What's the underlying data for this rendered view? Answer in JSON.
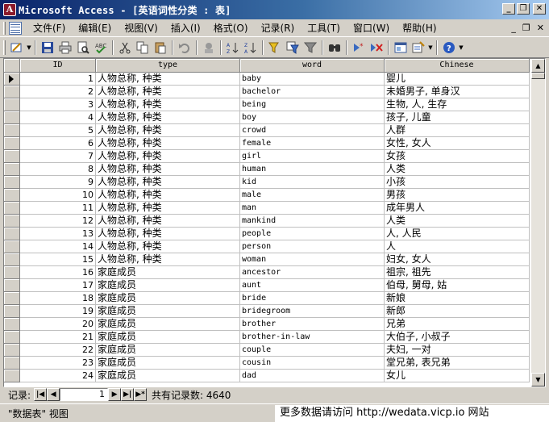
{
  "window": {
    "title": "Microsoft Access - [英语词性分类 : 表]",
    "buttons": {
      "minimize": "_",
      "restore": "❐",
      "close": "✕"
    }
  },
  "menubar": {
    "items": [
      "文件(F)",
      "编辑(E)",
      "视图(V)",
      "插入(I)",
      "格式(O)",
      "记录(R)",
      "工具(T)",
      "窗口(W)",
      "帮助(H)"
    ],
    "doc_controls": {
      "minimize": "_",
      "restore": "❐",
      "close": "✕"
    }
  },
  "toolbar": {
    "icons": [
      "view-icon",
      "save-icon",
      "print-icon",
      "print-preview-icon",
      "spelling-icon",
      "cut-icon",
      "copy-icon",
      "paste-icon",
      "undo-icon",
      "insert-object-icon",
      "sort-ascending-icon",
      "sort-descending-icon",
      "filter-by-selection-icon",
      "filter-by-form-icon",
      "apply-filter-icon",
      "find-icon",
      "new-record-icon",
      "delete-record-icon",
      "database-window-icon",
      "new-object-icon",
      "help-icon"
    ]
  },
  "grid": {
    "columns": [
      "ID",
      "type",
      "word",
      "Chinese"
    ],
    "rows": [
      {
        "id": "1",
        "type": "人物总称, 种类",
        "word": "baby",
        "chinese": "婴儿"
      },
      {
        "id": "2",
        "type": "人物总称, 种类",
        "word": "bachelor",
        "chinese": "未婚男子, 单身汉"
      },
      {
        "id": "3",
        "type": "人物总称, 种类",
        "word": "being",
        "chinese": "生物, 人, 生存"
      },
      {
        "id": "4",
        "type": "人物总称, 种类",
        "word": "boy",
        "chinese": "孩子, 儿童"
      },
      {
        "id": "5",
        "type": "人物总称, 种类",
        "word": "crowd",
        "chinese": "人群"
      },
      {
        "id": "6",
        "type": "人物总称, 种类",
        "word": "female",
        "chinese": "女性, 女人"
      },
      {
        "id": "7",
        "type": "人物总称, 种类",
        "word": "girl",
        "chinese": "女孩"
      },
      {
        "id": "8",
        "type": "人物总称, 种类",
        "word": "human",
        "chinese": "人类"
      },
      {
        "id": "9",
        "type": "人物总称, 种类",
        "word": "kid",
        "chinese": "小孩"
      },
      {
        "id": "10",
        "type": "人物总称, 种类",
        "word": "male",
        "chinese": "男孩"
      },
      {
        "id": "11",
        "type": "人物总称, 种类",
        "word": "man",
        "chinese": "成年男人"
      },
      {
        "id": "12",
        "type": "人物总称, 种类",
        "word": "mankind",
        "chinese": "人类"
      },
      {
        "id": "13",
        "type": "人物总称, 种类",
        "word": "people",
        "chinese": "人, 人民"
      },
      {
        "id": "14",
        "type": "人物总称, 种类",
        "word": "person",
        "chinese": "人"
      },
      {
        "id": "15",
        "type": "人物总称, 种类",
        "word": "woman",
        "chinese": "妇女, 女人"
      },
      {
        "id": "16",
        "type": "家庭成员",
        "word": "ancestor",
        "chinese": "祖宗, 祖先"
      },
      {
        "id": "17",
        "type": "家庭成员",
        "word": "aunt",
        "chinese": "伯母, 舅母, 姑"
      },
      {
        "id": "18",
        "type": "家庭成员",
        "word": "bride",
        "chinese": "新娘"
      },
      {
        "id": "19",
        "type": "家庭成员",
        "word": "bridegroom",
        "chinese": "新郎"
      },
      {
        "id": "20",
        "type": "家庭成员",
        "word": "brother",
        "chinese": "兄弟"
      },
      {
        "id": "21",
        "type": "家庭成员",
        "word": "brother-in-law",
        "chinese": "大伯子, 小叔子"
      },
      {
        "id": "22",
        "type": "家庭成员",
        "word": "couple",
        "chinese": "夫妇, 一对"
      },
      {
        "id": "23",
        "type": "家庭成员",
        "word": "cousin",
        "chinese": "堂兄弟, 表兄弟"
      },
      {
        "id": "24",
        "type": "家庭成员",
        "word": "dad",
        "chinese": "女儿"
      }
    ]
  },
  "navigator": {
    "label": "记录:",
    "first": "|◀",
    "prev": "◀",
    "current": "1",
    "next": "▶",
    "last": "▶|",
    "new": "▶*",
    "total_text": "共有记录数: 4640"
  },
  "status": {
    "view": "\"数据表\" 视图",
    "watermark": "更多数据请访问 http://wedata.vicp.io 网站"
  }
}
